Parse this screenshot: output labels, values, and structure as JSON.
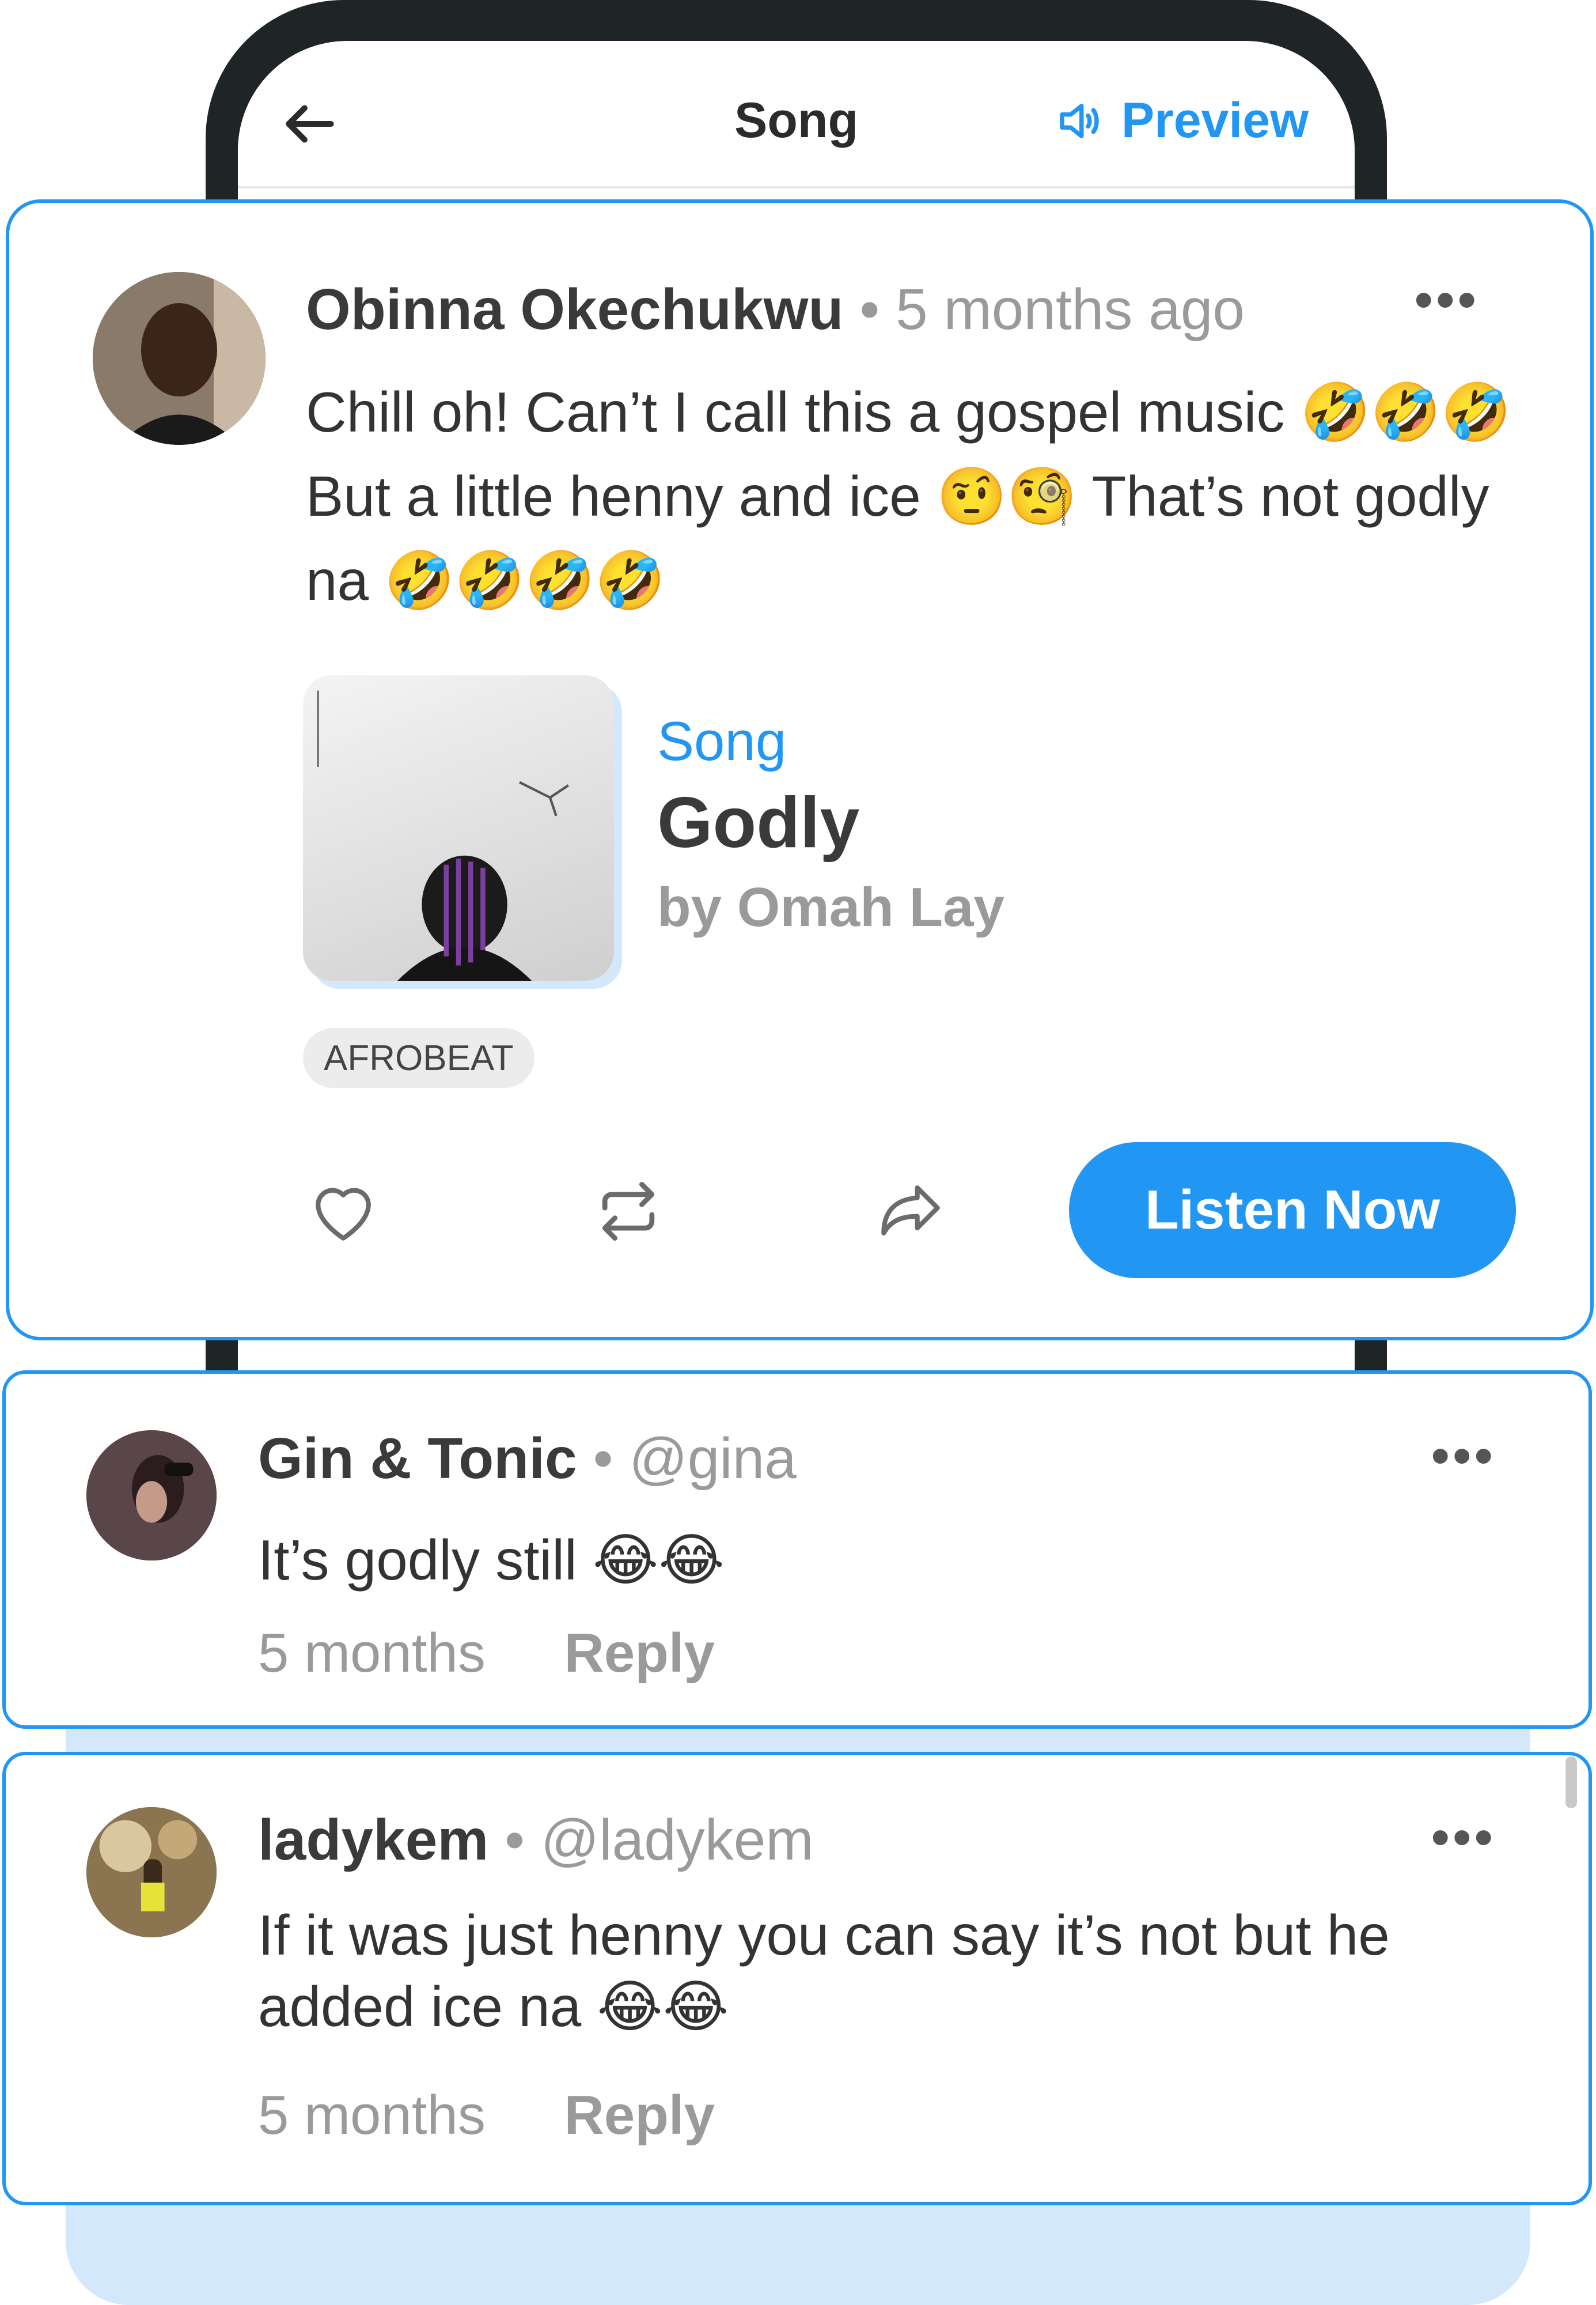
{
  "header": {
    "title": "Song",
    "preview_label": "Preview"
  },
  "post": {
    "author": "Obinna Okechukwu",
    "time": "5 months ago",
    "text": "Chill oh! Can’t I call this a gospel music 🤣🤣🤣 But a little henny and ice 🤨🧐 That’s not godly na 🤣🤣🤣🤣",
    "song": {
      "kind": "Song",
      "title": "Godly",
      "artist": "by Omah Lay"
    },
    "tag": "AFROBEAT",
    "listen_label": "Listen Now"
  },
  "comments": [
    {
      "author": "Gin & Tonic",
      "handle": "@gina",
      "text": "It’s godly still 😂😂",
      "time": "5 months",
      "reply_label": "Reply"
    },
    {
      "author": "ladykem",
      "handle": "@ladykem",
      "text": "If it was just henny you can say it’s not but he added ice na 😂😂",
      "time": "5 months",
      "reply_label": "Reply"
    }
  ],
  "colors": {
    "accent": "#2196f3",
    "backdrop": "#d4e8fb"
  }
}
